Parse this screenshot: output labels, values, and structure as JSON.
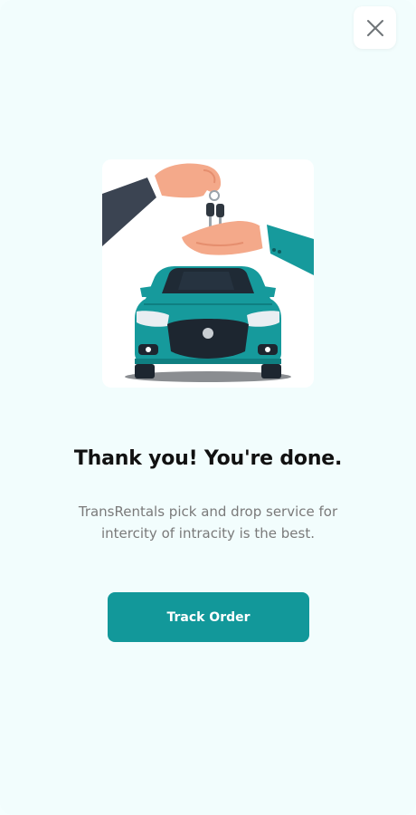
{
  "header": {
    "close_icon": "close-icon"
  },
  "illustration": {
    "icon": "car-key-handover-illustration",
    "accent_color": "#169a9c"
  },
  "confirmation": {
    "title": "Thank you! You're done.",
    "description": "TransRentals pick and drop service for intercity of intracity is the best."
  },
  "actions": {
    "track_order_label": "Track Order",
    "button_color": "#12989a"
  }
}
